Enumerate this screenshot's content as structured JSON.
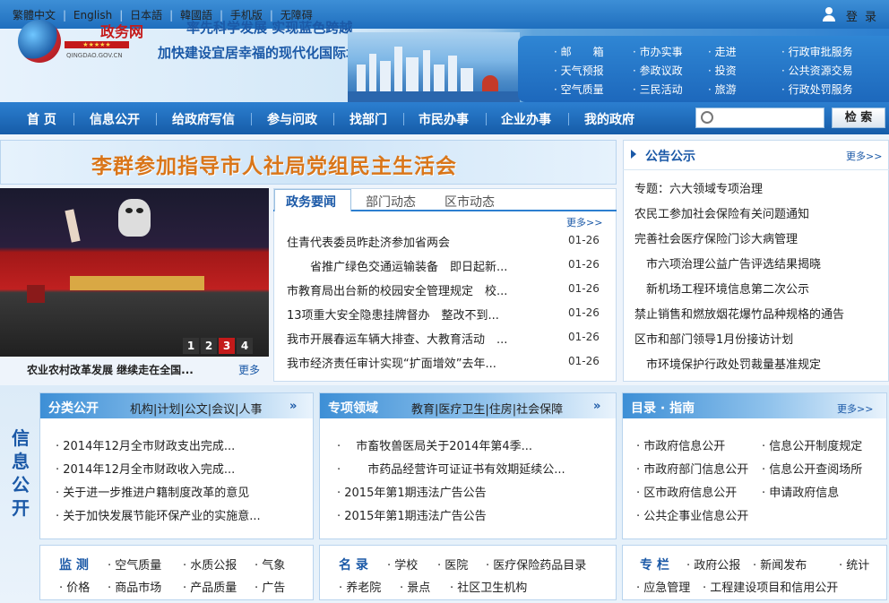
{
  "topbar": {
    "langs": [
      "繁體中文",
      "English",
      "日本語",
      "韓國語",
      "手机版",
      "无障碍"
    ],
    "login": "登 录"
  },
  "header": {
    "logo_text": "政务网",
    "logo_url": "QINGDAO.GOV.CN",
    "slogan_line1": "率先科学发展 实现蓝色跨越",
    "slogan_line2": "加快建设宜居幸福的现代化国际城市",
    "quicklinks": [
      "邮　　箱",
      "市办实事",
      "走进",
      "行政审批服务",
      "天气预报",
      "参政议政",
      "投资",
      "公共资源交易",
      "空气质量",
      "三民活动",
      "旅游",
      "行政处罚服务"
    ]
  },
  "nav": {
    "items": [
      "首 页",
      "信息公开",
      "给政府写信",
      "参与问政",
      "找部门",
      "市民办事",
      "企业办事",
      "我的政府"
    ],
    "search_placeholder": "",
    "search_label": "检 索"
  },
  "banner": {
    "text": "李群参加指导市人社局党组民主生活会"
  },
  "photo": {
    "pages": [
      "1",
      "2",
      "3",
      "4"
    ],
    "active_page": "3",
    "caption": "农业农村改革发展 继续走在全国...",
    "more": "更多"
  },
  "news": {
    "tabs": [
      "政务要闻",
      "部门动态",
      "区市动态"
    ],
    "more": "更多>>",
    "items": [
      {
        "title": "住青代表委员昨赴济参加省两会",
        "date": "01-26"
      },
      {
        "title": "　　省推广绿色交通运输装备　即日起新...",
        "date": "01-26"
      },
      {
        "title": "市教育局出台新的校园安全管理规定　校...",
        "date": "01-26"
      },
      {
        "title": "13项重大安全隐患挂牌督办　整改不到...",
        "date": "01-26"
      },
      {
        "title": "我市开展春运车辆大排查、大教育活动　...",
        "date": "01-26"
      },
      {
        "title": "我市经济责任审计实现“扩面增效”去年...",
        "date": "01-26"
      }
    ]
  },
  "notice": {
    "title": "公告公示",
    "more": "更多>>",
    "items": [
      "专题：六大领域专项治理",
      "农民工参加社会保险有关问题通知",
      "完善社会医疗保险门诊大病管理",
      "　市六项治理公益广告评选结果揭晓",
      "　新机场工程环境信息第二次公示",
      "禁止销售和燃放烟花爆竹品种规格的通告",
      "区市和部门领导1月份接访计划",
      "　市环境保护行政处罚裁量基准规定"
    ]
  },
  "info_public": {
    "vertical_title": "信息公开",
    "box1": {
      "title": "分类公开",
      "tabs": "机构|计划|公文|会议|人事",
      "items": [
        "2014年12月全市财政支出完成...",
        "2014年12月全市财政收入完成...",
        "关于进一步推进户籍制度改革的意见",
        "关于加快发展节能环保产业的实施意..."
      ]
    },
    "box2": {
      "title": "专项领域",
      "tabs": "教育|医疗卫生|住房|社会保障",
      "items": [
        "　市畜牧兽医局关于2014年第4季...",
        "　　市药品经营许可证证书有效期延续公...",
        "2015年第1期违法广告公告",
        "2015年第1期违法广告公告"
      ]
    },
    "box3": {
      "title": "目录 · 指南",
      "more": "更多>>",
      "items": [
        "市政府信息公开",
        "信息公开制度规定",
        "市政府部门信息公开",
        "信息公开查阅场所",
        "区市政府信息公开",
        "申请政府信息",
        "公共企事业信息公开"
      ]
    }
  },
  "small_boxes": {
    "monitor": {
      "title": "监 测",
      "items": [
        "空气质量",
        "水质公报",
        "气象",
        "价格",
        "商品市场",
        "产品质量",
        "广告"
      ]
    },
    "directory": {
      "title": "名 录",
      "items": [
        "学校",
        "医院",
        "医疗保险药品目录",
        "养老院",
        "景点",
        "社区卫生机构"
      ]
    },
    "special": {
      "title": "专 栏",
      "items": [
        "政府公报",
        "新闻发布",
        "统计",
        "应急管理",
        "工程建设项目和信用公开"
      ]
    }
  }
}
